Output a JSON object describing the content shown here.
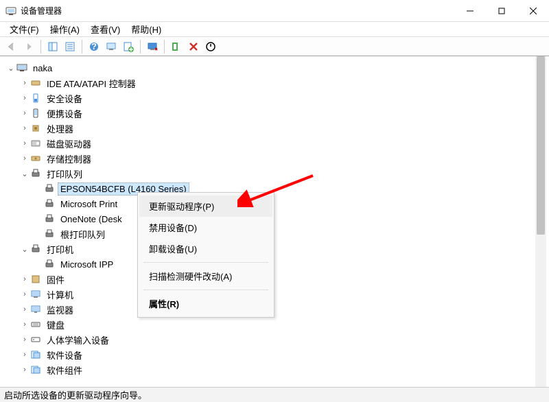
{
  "window": {
    "title": "设备管理器"
  },
  "menubar": {
    "file": "文件(F)",
    "action": "操作(A)",
    "view": "查看(V)",
    "help": "帮助(H)"
  },
  "tree": {
    "root": "naka",
    "nodes": {
      "ide": "IDE ATA/ATAPI 控制器",
      "security": "安全设备",
      "portable": "便携设备",
      "cpu": "处理器",
      "disk": "磁盘驱动器",
      "storage": "存储控制器",
      "printqueue": "打印队列",
      "printers": "打印机",
      "firmware": "固件",
      "computer": "计算机",
      "monitor": "监视器",
      "keyboard": "键盘",
      "hid": "人体学输入设备",
      "swdev": "软件设备",
      "swcomp": "软件组件"
    },
    "printqueue_children": {
      "epson": "EPSON54BCFB (L4160 Series)",
      "msprint": "Microsoft Print",
      "onenote": "OneNote (Desk",
      "root": "根打印队列"
    },
    "printers_children": {
      "ipp": "Microsoft IPP"
    }
  },
  "context_menu": {
    "update": "更新驱动程序(P)",
    "disable": "禁用设备(D)",
    "uninstall": "卸载设备(U)",
    "scan": "扫描检测硬件改动(A)",
    "properties": "属性(R)"
  },
  "statusbar": {
    "text": "启动所选设备的更新驱动程序向导。"
  }
}
